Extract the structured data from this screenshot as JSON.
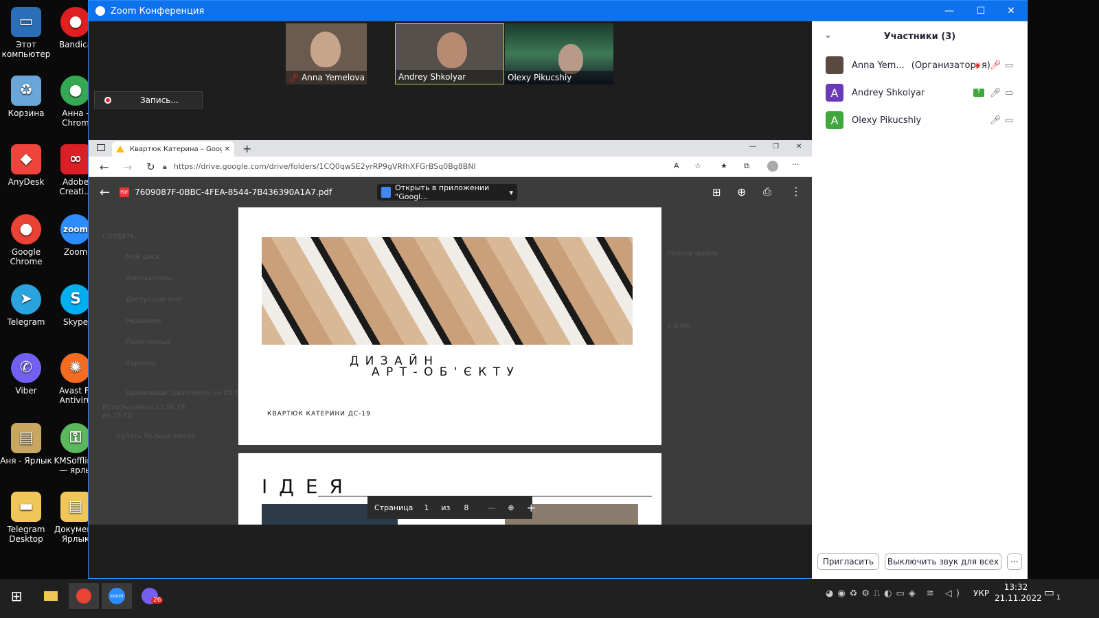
{
  "desktop": {
    "icons": [
      {
        "label": "Этот компьютер"
      },
      {
        "label": "Корзина"
      },
      {
        "label": "AnyDesk"
      },
      {
        "label": "Google Chrome"
      },
      {
        "label": "Telegram"
      },
      {
        "label": "Viber"
      },
      {
        "label": "Аня - Ярлык"
      },
      {
        "label": "Telegram Desktop"
      },
      {
        "label": "Bandica"
      },
      {
        "label": "Анна - Chrom"
      },
      {
        "label": "Adobe Creati..."
      },
      {
        "label": "Zoom"
      },
      {
        "label": "Skype"
      },
      {
        "label": "Avast Fr Antiviru"
      },
      {
        "label": "KMSoffline — ярлы"
      },
      {
        "label": "Документ Ярлык"
      }
    ]
  },
  "zoom": {
    "title": "Zoom Конференция",
    "videos": [
      {
        "name": "Anna Yemelova"
      },
      {
        "name": "Andrey Shkolyar"
      },
      {
        "name": "Olexy Pikucshiy"
      }
    ],
    "recording_label": "Запись...",
    "participants_title": "Участники (3)",
    "participants": [
      {
        "name": "Anna Yem...",
        "role": "(Организатор, я)",
        "initial": ""
      },
      {
        "name": "Andrey Shkolyar",
        "role": "",
        "initial": "A"
      },
      {
        "name": "Olexy Pikucshiy",
        "role": "",
        "initial": "A"
      }
    ],
    "invite_button": "Пригласить",
    "mute_all_button": "Выключить звук для всех",
    "more_button": "···"
  },
  "browser": {
    "tab_title": "Квартюк Катерина – Google Ди...",
    "url": "https://drive.google.com/drive/folders/1CQ0qwSE2yrRP9gVRfhXFGrBSq0Bg8BNI",
    "pdf_filename": "7609087F-0BBC-4FEA-8544-7B436390A1A7.pdf",
    "open_in_app": "Открыть в приложении \"Googl...",
    "page1_title_line1": "Д И З А Й Н",
    "page1_title_line2": "А Р Т - О Б ' Є К Т У",
    "page1_author": "КВАРТЮК КАТЕРИНИ ДС-19",
    "page2_title": "І Д Е Я",
    "page_label": "Страница",
    "page_current": "1",
    "page_of": "из",
    "page_total": "8"
  },
  "drive_bg": {
    "create": "Создать",
    "my_drive": "Мой диск",
    "computers": "Компьютеры",
    "shared": "Доступные мне",
    "recent": "Недавние",
    "starred": "Помеченные",
    "trash": "Корзина",
    "storage": "Хранилище (заполнено на 85 %)",
    "storage_used": "Использовано 12,86 ГБ из 15 ГБ",
    "buy_more": "Купить больше места",
    "file_size_header": "Размер файла",
    "file_size_value": "2,4 МБ"
  },
  "taskbar": {
    "language": "УКР",
    "time": "13:32",
    "date": "21.11.2022",
    "viber_badge": "26",
    "notification_count": "1"
  },
  "colors": {
    "zoom_blue": "#0e72ed",
    "avatar_purple": "#6b3ab7",
    "avatar_green": "#3fa73b"
  }
}
